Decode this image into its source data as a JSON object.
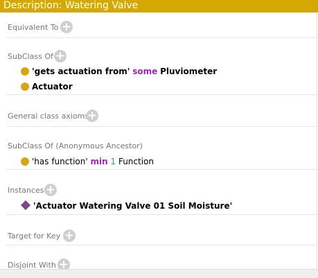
{
  "title": "Description: Watering Valve",
  "sections": {
    "equivalent_to": "Equivalent To",
    "subclass_of": "SubClass Of",
    "general_class_axioms": "General class axioms",
    "subclass_of_anonymous": "SubClass Of (Anonymous Ancestor)",
    "instances": "Instances",
    "target_for_key": "Target for Key",
    "disjoint_with": "Disjoint With"
  },
  "subclass_axioms": {
    "a1": {
      "property": "'gets actuation from'",
      "keyword": "some",
      "filler": "Pluviometer"
    },
    "a2": {
      "class": "Actuator"
    }
  },
  "anonymous_axioms": {
    "a1": {
      "property": "'has function'",
      "keyword": "min",
      "number": "1",
      "filler": "Function"
    }
  },
  "instances": {
    "i1": "'Actuator Watering  Valve 01 Soil Moisture'"
  },
  "add_symbol": "+",
  "colors": {
    "title_bar": "#d4a800",
    "class_dot": "#d4a617",
    "individual_diamond": "#7a4a8a",
    "keyword": "#9c27b0",
    "number": "#2196f3"
  }
}
